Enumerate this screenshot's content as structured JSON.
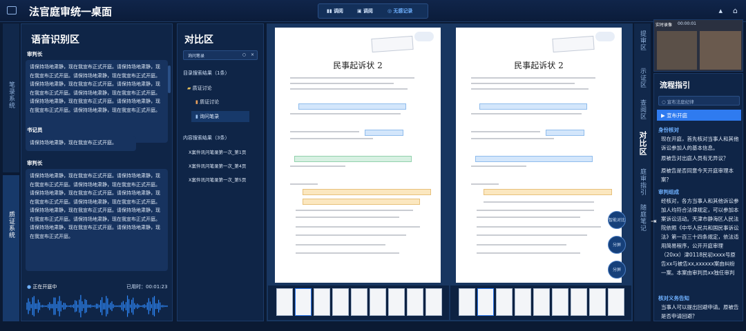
{
  "app": {
    "title": "法官庭审统一桌面"
  },
  "toolbar": {
    "btn1": "调阅",
    "btn2": "调阅",
    "btn3": "无感记录"
  },
  "left_rail": {
    "top": "笔录系统",
    "bottom": "质证系统"
  },
  "speech": {
    "title": "语音识别区",
    "entries": [
      {
        "speaker": "审判长",
        "text": "请保持场地肃静，现在我宣布正式开庭。请保持场地肃静，现在我宣布正式开庭。请保持场地肃静，现在我宣布正式开庭。请保持场地肃静，现在我宣布正式开庭。请保持场地肃静，现在我宣布正式开庭。请保持场地肃静，现在我宣布正式开庭。请保持场地肃静，现在我宣布正式开庭。请保持场地肃静，现在我宣布正式开庭。请保持场地肃静，现在我宣布正式开庭。"
      },
      {
        "speaker": "书记员",
        "text": "请保持场地肃静，现在我宣布正式开庭。"
      },
      {
        "speaker": "审判长",
        "text": "请保持场地肃静，现在我宣布正式开庭。请保持场地肃静，现在我宣布正式开庭。请保持场地肃静，现在我宣布正式开庭。请保持场地肃静，现在我宣布正式开庭。请保持场地肃静，现在我宣布正式开庭。请保持场地肃静，现在我宣布正式开庭。请保持场地肃静，现在我宣布正式开庭。请保持场地肃静，现在我宣布正式开庭。请保持场地肃静，现在我宣布正式开庭。请保持场地肃静，现在我宣布正式开庭。请保持场地肃静，现在我宣布正式开庭。"
      }
    ],
    "status": "正在开庭中",
    "elapsed": "已用时：00:01:23"
  },
  "compare": {
    "title": "对比区",
    "search_placeholder": "询问笔录",
    "dir_heading": "目录搜索结果（1条）",
    "tree": [
      "质证讨论",
      "质证讨论",
      "询问笔录"
    ],
    "content_heading": "内容搜索结果（3条）",
    "results": [
      "X案件讯问笔录第一次_第1页",
      "X案件讯问笔录第一次_第4页",
      "X案件讯问笔录第一次_第5页"
    ]
  },
  "docs": {
    "left_title": "民事起诉状 2",
    "right_title": "民事起诉状 2"
  },
  "side_tabs": [
    "提审区",
    "示证区",
    "查阅区",
    "对比区",
    "庭审指引",
    "随庭笔记"
  ],
  "fabs": [
    "智能对比",
    "分屏",
    "分屏"
  ],
  "video": {
    "label": "实时录像",
    "time": "00:00:01"
  },
  "guide": {
    "title": "流程指引",
    "search_placeholder": "宣布法庭纪律",
    "active_step": "宣布开庭",
    "sections": [
      {
        "heading": "身份核对",
        "items": [
          "现在开庭，首先核对当事人和其他诉讼参加人的基本信息。",
          "原被告对出庭人员有无异议？",
          "原被告是否同意今天开庭审理本案？"
        ]
      },
      {
        "heading": "审判组成",
        "items": [
          "经核对，各方当事人和其他诉讼参加人均符合法律规定，可以参加本案诉讼活动。天津市静海区人民法院依照《中华人民共和国民事诉讼法》第一百三十四条规定，依法适用简易程序，公开开庭审理（20xx）津0118民初xxxx号原告xx与被告xx,xxxxxx案由纠纷一案。本案由审判员xx独任审判"
        ]
      },
      {
        "heading": "核对义务告知",
        "items": [
          "当事人可以提出回避申请。原被告是否申请回避？"
        ]
      }
    ]
  },
  "colors": {
    "accent": "#2f7bf0",
    "bg": "#0b1a33",
    "panel": "#0f2547"
  }
}
